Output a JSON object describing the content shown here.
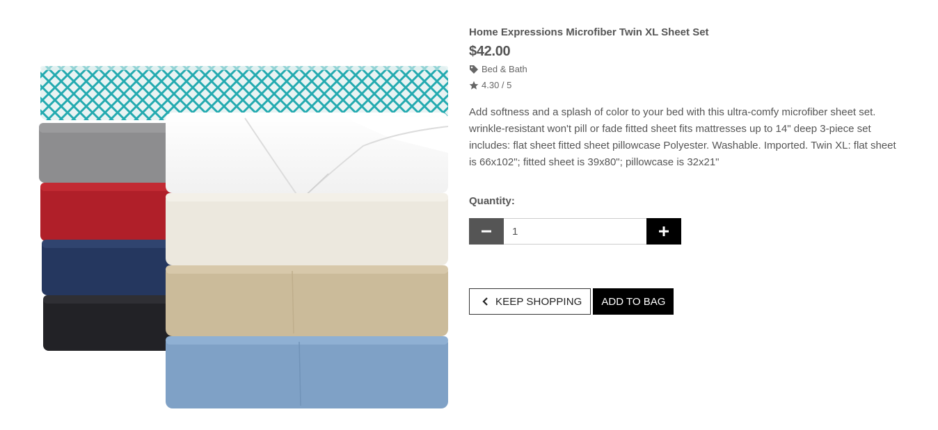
{
  "product": {
    "title": "Home Expressions Microfiber Twin XL Sheet Set",
    "price": "$42.00",
    "category": "Bed & Bath",
    "rating": "4.30 / 5",
    "description": "Add softness and a splash of color to your bed with this ultra-comfy microfiber sheet set. wrinkle-resistant won't pill or fade fitted sheet fits mattresses up to 14\" deep 3-piece set includes: flat sheet fitted sheet pillowcase Polyester. Washable. Imported. Twin XL: flat sheet is 66x102\"; fitted sheet is 39x80\"; pillowcase is 32x21\""
  },
  "quantity": {
    "label": "Quantity:",
    "value": "1",
    "minus_icon": "minus-icon",
    "plus_icon": "plus-icon"
  },
  "actions": {
    "keep_shopping": "KEEP SHOPPING",
    "add_to_bag": "ADD TO BAG"
  },
  "icons": {
    "category": "tag-icon",
    "rating": "star-icon",
    "keep_shopping": "chevron-left-icon"
  },
  "colors": {
    "qty_minus_bg": "#555555",
    "qty_plus_bg": "#000000",
    "add_to_bag_bg": "#000000",
    "sheet_colors": [
      "#2bb3b8",
      "#8e8e8e",
      "#b0202a",
      "#273a66",
      "#222226",
      "#ffffff",
      "#ece8de",
      "#cbbb9a",
      "#7fa1c6"
    ]
  }
}
